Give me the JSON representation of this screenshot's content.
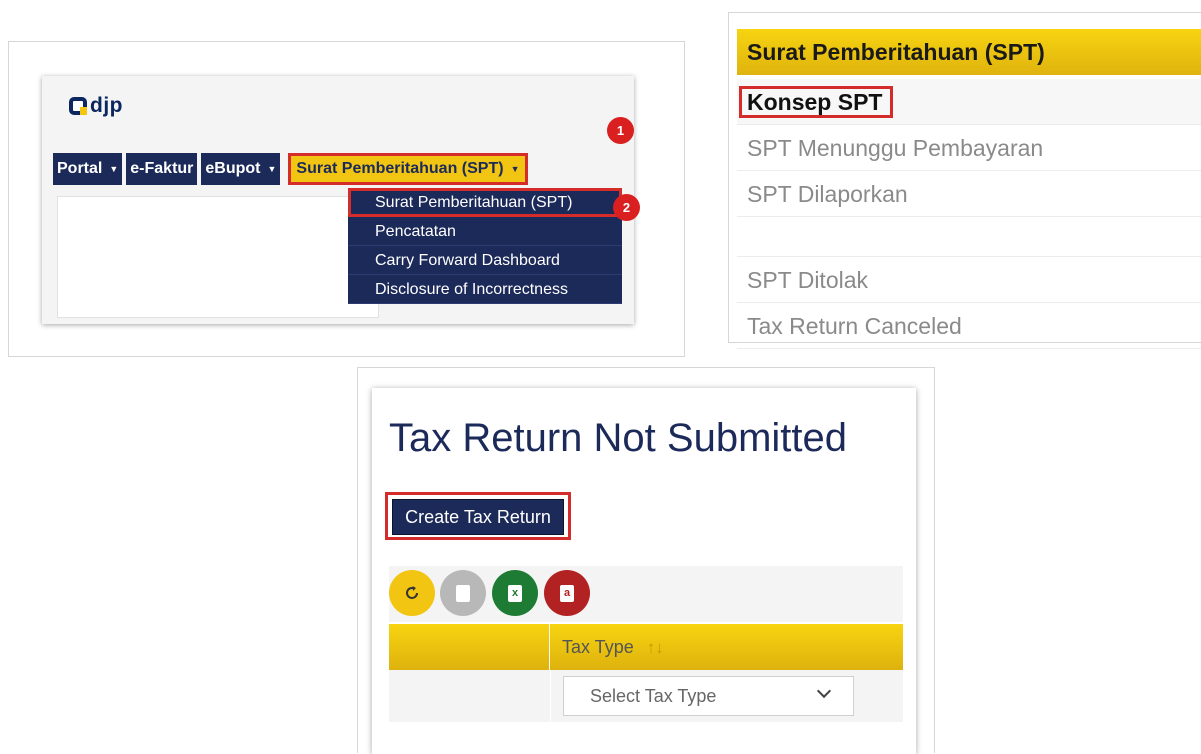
{
  "navigation_panel": {
    "logo_text": "djp",
    "nav": [
      "Portal",
      "e-Faktur",
      "eBupot",
      "Surat Pemberitahuan (SPT)"
    ],
    "dropdown": [
      "Surat Pemberitahuan (SPT)",
      "Pencatatan",
      "Carry Forward Dashboard",
      "Disclosure of Incorrectness"
    ],
    "step_badges": [
      "1",
      "2"
    ]
  },
  "spt_menu_panel": {
    "header": "Surat Pemberitahuan (SPT)",
    "items": [
      "Konsep SPT",
      "SPT Menunggu Pembayaran",
      "SPT Dilaporkan",
      "",
      "SPT Ditolak",
      "Tax Return Canceled"
    ]
  },
  "tax_return_panel": {
    "title": "Tax Return Not Submitted",
    "create_button": "Create Tax Return",
    "toolbar": [
      {
        "icon": "refresh-icon",
        "color": "#f2c512"
      },
      {
        "icon": "document-icon",
        "color": "#b8b8b8"
      },
      {
        "icon": "excel-icon",
        "color": "#1e7b34"
      },
      {
        "icon": "pdf-icon",
        "color": "#b22222"
      }
    ],
    "table": {
      "col1_header": "",
      "col2_header": "Tax Type",
      "tax_type_select": "Select Tax Type"
    }
  },
  "colors": {
    "navy": "#1c2a5a",
    "yellow": "#f2c512",
    "highlight_red": "#d42b2b"
  }
}
